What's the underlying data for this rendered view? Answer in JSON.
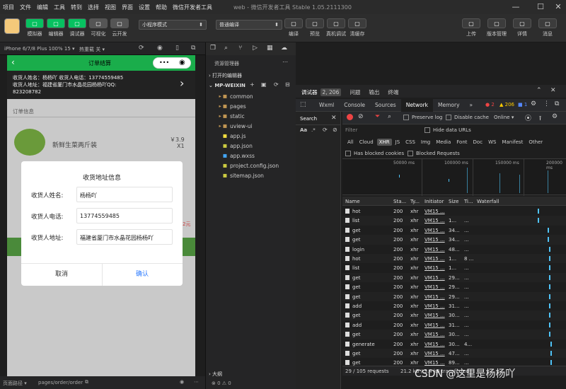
{
  "menu": [
    "项目",
    "文件",
    "编辑",
    "工具",
    "转到",
    "选择",
    "视图",
    "界面",
    "设置",
    "帮助",
    "微信开发者工具"
  ],
  "window_title": "web - 微信开发者工具 Stable 1.05.2111300",
  "toolbar": {
    "left": [
      {
        "label": "模拟器",
        "color": "#07c160",
        "icon": "phone-icon"
      },
      {
        "label": "编辑器",
        "color": "#07c160",
        "icon": "code-icon"
      },
      {
        "label": "调试器",
        "color": "#07c160",
        "icon": "debug-icon"
      },
      {
        "label": "可视化",
        "color": "#555",
        "icon": "visual-icon"
      },
      {
        "label": "云开发",
        "color": "#555",
        "icon": "cloud-icon"
      }
    ],
    "mode_select": "小程序模式",
    "compile_select": "普通编译",
    "mid": [
      {
        "label": "编译",
        "icon": "refresh-icon"
      },
      {
        "label": "预览",
        "icon": "eye-icon"
      },
      {
        "label": "真机调试",
        "icon": "bug-icon"
      },
      {
        "label": "清缓存",
        "icon": "layers-icon"
      }
    ],
    "right": [
      {
        "label": "上传",
        "icon": "upload-icon"
      },
      {
        "label": "版本管理",
        "icon": "branch-icon"
      },
      {
        "label": "详情",
        "icon": "menu-icon"
      },
      {
        "label": "消息",
        "icon": "bell-icon"
      }
    ]
  },
  "sim": {
    "device": "iPhone 6/7/8 Plus 100% 15 ▾",
    "hotreload": "热重载 关 ▾",
    "nav_title": "订单结算",
    "addr_line1": "收货人姓名：杨杨吖  收货人电话：13774559485",
    "addr_line2": "收货人地址：福建省厦门市水晶花园杨杨吖QQ:",
    "addr_line3": "823208782",
    "order_info": "订单信息",
    "product_name": "新鲜生菜两斤装",
    "product_price": "￥3.9",
    "product_qty": "X1",
    "dialog": {
      "title": "收货地址信息",
      "fields": [
        {
          "label": "收货人姓名:",
          "value": "杨杨吖"
        },
        {
          "label": "收货人电话:",
          "value": "13774559485"
        },
        {
          "label": "收货人地址:",
          "value": "福建省厦门市水晶花园杨杨吖"
        }
      ],
      "cancel": "取消",
      "confirm": "确认"
    },
    "behind_price": "2元"
  },
  "status": {
    "path_label": "页面路径 ▾",
    "path": "pages/order/order",
    "warn": "⊗ 0 ⚠ 0"
  },
  "explorer": {
    "title": "资源管理器",
    "open_editors": "打开的编辑器",
    "root": "MP-WEIXIN",
    "items": [
      {
        "name": "common",
        "type": "folder"
      },
      {
        "name": "pages",
        "type": "folder"
      },
      {
        "name": "static",
        "type": "folder"
      },
      {
        "name": "uview-ui",
        "type": "folder"
      },
      {
        "name": "app.js",
        "type": "js"
      },
      {
        "name": "app.json",
        "type": "json"
      },
      {
        "name": "app.wxss",
        "type": "wxss"
      },
      {
        "name": "project.config.json",
        "type": "json"
      },
      {
        "name": "sitemap.json",
        "type": "json"
      }
    ],
    "outline": "大纲"
  },
  "devtools": {
    "top_tabs": [
      "调试器",
      "2, 206",
      "问题",
      "输出",
      "终端"
    ],
    "tabs": [
      "Wxml",
      "Console",
      "Sources",
      "Network",
      "Memory",
      "»"
    ],
    "err_count": "2",
    "warn_count": "206",
    "info_count": "1",
    "search": "Search",
    "preserve_log": "Preserve log",
    "disable_cache": "Disable cache",
    "online": "Online",
    "filter": "Filter",
    "hide_data_urls": "Hide data URLs",
    "types": [
      "All",
      "Cloud",
      "XHR",
      "JS",
      "CSS",
      "Img",
      "Media",
      "Font",
      "Doc",
      "WS",
      "Manifest",
      "Other"
    ],
    "has_blocked": "Has blocked cookies",
    "blocked_req": "Blocked Requests",
    "timeline_ticks": [
      "50000 ms",
      "100000 ms",
      "150000 ms",
      "200000 ms"
    ],
    "columns": [
      "Name",
      "Sta...",
      "Ty...",
      "Initiator",
      "Size",
      "Ti...",
      "Waterfall"
    ],
    "rows": [
      {
        "name": "hot",
        "status": "200",
        "type": "xhr",
        "init": "VM15 ...",
        "size": "",
        "time": ""
      },
      {
        "name": "list",
        "status": "200",
        "type": "xhr",
        "init": "VM15 ...",
        "size": "1...",
        "time": "..."
      },
      {
        "name": "get",
        "status": "200",
        "type": "xhr",
        "init": "VM15 ...",
        "size": "34...",
        "time": "..."
      },
      {
        "name": "get",
        "status": "200",
        "type": "xhr",
        "init": "VM15 ...",
        "size": "34...",
        "time": "..."
      },
      {
        "name": "login",
        "status": "200",
        "type": "xhr",
        "init": "VM15 ...",
        "size": "48...",
        "time": "..."
      },
      {
        "name": "hot",
        "status": "200",
        "type": "xhr",
        "init": "VM15 ...",
        "size": "1...",
        "time": "8 ..."
      },
      {
        "name": "list",
        "status": "200",
        "type": "xhr",
        "init": "VM15 ...",
        "size": "1...",
        "time": "..."
      },
      {
        "name": "get",
        "status": "200",
        "type": "xhr",
        "init": "VM15 ...",
        "size": "29...",
        "time": "..."
      },
      {
        "name": "get",
        "status": "200",
        "type": "xhr",
        "init": "VM15 ...",
        "size": "29...",
        "time": "..."
      },
      {
        "name": "get",
        "status": "200",
        "type": "xhr",
        "init": "VM15 ...",
        "size": "29...",
        "time": "..."
      },
      {
        "name": "add",
        "status": "200",
        "type": "xhr",
        "init": "VM15 ...",
        "size": "31...",
        "time": "..."
      },
      {
        "name": "get",
        "status": "200",
        "type": "xhr",
        "init": "VM15 ...",
        "size": "30...",
        "time": "..."
      },
      {
        "name": "add",
        "status": "200",
        "type": "xhr",
        "init": "VM15 ...",
        "size": "31...",
        "time": "..."
      },
      {
        "name": "get",
        "status": "200",
        "type": "xhr",
        "init": "VM15 ...",
        "size": "30...",
        "time": "..."
      },
      {
        "name": "generate",
        "status": "200",
        "type": "xhr",
        "init": "VM15 ...",
        "size": "30...",
        "time": "4..."
      },
      {
        "name": "get",
        "status": "200",
        "type": "xhr",
        "init": "VM15 ...",
        "size": "47...",
        "time": "..."
      },
      {
        "name": "get",
        "status": "200",
        "type": "xhr",
        "init": "VM15 ...",
        "size": "89...",
        "time": "..."
      }
    ],
    "summary_requests": "29 / 105 requests",
    "summary_size": "21.2 kB / 3.4 kB transferred",
    "watermark": "CSDN @这里是杨杨吖"
  }
}
